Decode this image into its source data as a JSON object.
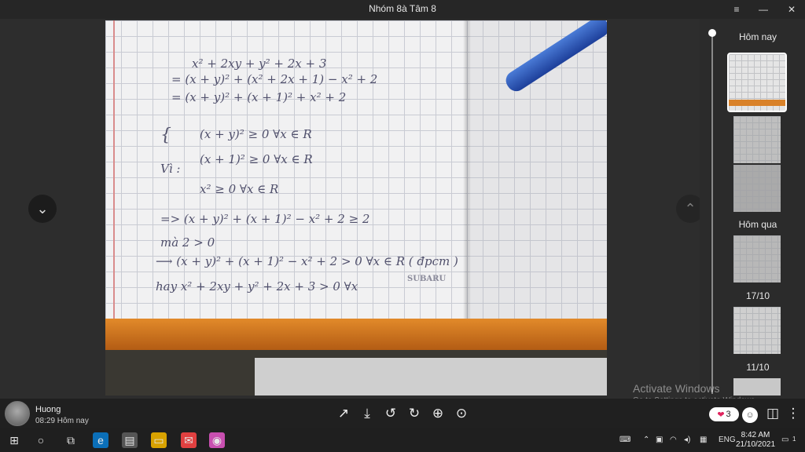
{
  "window": {
    "title": "Nhóm 8à Tâm 8",
    "minimize_label": "—",
    "maximize_label": "☐",
    "close_label": "✕",
    "menu_label": "≡"
  },
  "photo": {
    "handwriting": [
      "x² + 2xy + y² + 2x + 3",
      "= (x + y)² + (x² + 2x + 1) − x² + 2",
      "= (x + y)² + (x + 1)² + x² + 2",
      "(x + y)² ≥ 0   ∀x  ∈ R",
      "Vì :",
      "(x + 1)² ≥ 0   ∀x  ∈ R",
      "x² ≥ 0   ∀x  ∈ R",
      "=> (x + y)² + (x + 1)² − x² + 2 ≥ 2",
      "mà   2 > 0",
      "⟶ (x + y)² + (x + 1)² − x² + 2 > 0   ∀x ∈ R  ( đpcm )",
      "hay  x² + 2xy + y² + 2x + 3 > 0  ∀x"
    ],
    "brand": "SUBARU"
  },
  "nav": {
    "prev_icon": "chevron-down-icon",
    "next_icon": "chevron-up-icon"
  },
  "panel": {
    "groups": [
      {
        "label": "Hôm nay"
      },
      {
        "label": "Hôm qua"
      },
      {
        "label": "17/10"
      },
      {
        "label": "11/10"
      }
    ]
  },
  "watermark": {
    "line1": "Activate Windows",
    "line2": "Go to Settings to activate Windows."
  },
  "info": {
    "user_name": "Huong",
    "time": "08:29 Hôm nay",
    "reaction_count": "3",
    "toolbar": [
      "share-icon",
      "download-icon",
      "rotate-left-icon",
      "rotate-right-icon",
      "zoom-in-icon",
      "zoom-fit-icon"
    ]
  },
  "taskbar": {
    "language": "ENG",
    "clock_time": "8:42 AM",
    "clock_date": "21/10/2021",
    "notification_badge": "1",
    "colors": {
      "accent": "#0078d7",
      "edge": "#e28a2a"
    }
  }
}
